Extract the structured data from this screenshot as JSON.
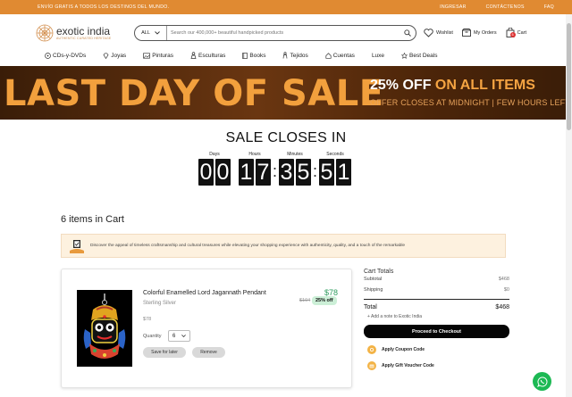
{
  "topbar": {
    "promo": "ENVÍO GRATIS A TODOS LOS DESTINOS DEL MUNDO.",
    "links": [
      "INGRESAR",
      "CONTÁCTENOS",
      "FAQ"
    ]
  },
  "header": {
    "logo_name": "exotic india",
    "logo_tagline": "AUTHENTIC CURATED HERITAGE",
    "search_category": "ALL",
    "search_placeholder": "Search our 400,000+ beautiful handpicked products",
    "wishlist_label": "Wishlist",
    "orders_label": "My Orders",
    "cart_label": "Cart",
    "cart_count": "6"
  },
  "nav": {
    "items": [
      {
        "label": "CDs-y-DVDs",
        "icon": "disc-icon"
      },
      {
        "label": "Joyas",
        "icon": "gem-icon"
      },
      {
        "label": "Pinturas",
        "icon": "painting-icon"
      },
      {
        "label": "Esculturas",
        "icon": "sculpture-icon"
      },
      {
        "label": "Books",
        "icon": "book-icon"
      },
      {
        "label": "Tejidos",
        "icon": "textile-icon"
      },
      {
        "label": "Cuentas",
        "icon": "beads-icon"
      },
      {
        "label": "Luxe",
        "icon": ""
      },
      {
        "label": "Best Deals",
        "icon": "deal-icon"
      }
    ]
  },
  "banner": {
    "headline": "LAST DAY OF SALE",
    "offer_highlight": "25% OFF",
    "offer_rest": " ON ALL ITEMS",
    "subline": "OFFER CLOSES AT MIDNIGHT | FEW HOURS LEFT"
  },
  "countdown": {
    "title": "SALE CLOSES IN",
    "units": [
      {
        "label": "Days",
        "digits": [
          "0",
          "0"
        ]
      },
      {
        "label": "Hours",
        "digits": [
          "1",
          "7"
        ]
      },
      {
        "label": "Minutes",
        "digits": [
          "3",
          "5"
        ]
      },
      {
        "label": "Seconds",
        "digits": [
          "5",
          "1"
        ]
      }
    ]
  },
  "cart": {
    "items_heading": "6 items in Cart",
    "notice": "Discover the appeal of timeless craftsmanship and cultural treasures while elevating your shopping experience with authenticity, quality, and a touch of the remarkable",
    "item": {
      "name": "Colorful Enamelled Lord Jagannath Pendant",
      "material": "Sterling Silver",
      "unit_price": "$78",
      "quantity_label": "Quantity",
      "quantity": "6",
      "price_new": "$78",
      "price_old": "$104",
      "discount": "25% off",
      "save_label": "Save for later",
      "remove_label": "Remove"
    }
  },
  "totals": {
    "title": "Cart Totals",
    "subtotal_label": "Subtotal",
    "subtotal_value": "$468",
    "shipping_label": "Shipping",
    "shipping_value": "$0",
    "total_label": "Total",
    "total_value": "$468",
    "note_label": "+ Add a note to Exotic India",
    "checkout_label": "Proceed to Checkout",
    "coupon_label": "Apply Coupon Code",
    "voucher_label": "Apply Gift Voucher Code"
  },
  "colors": {
    "topbar": "#e08a32",
    "banner_accent": "#f2a03d",
    "price_green": "#2d9c5e",
    "whatsapp": "#1db954"
  }
}
